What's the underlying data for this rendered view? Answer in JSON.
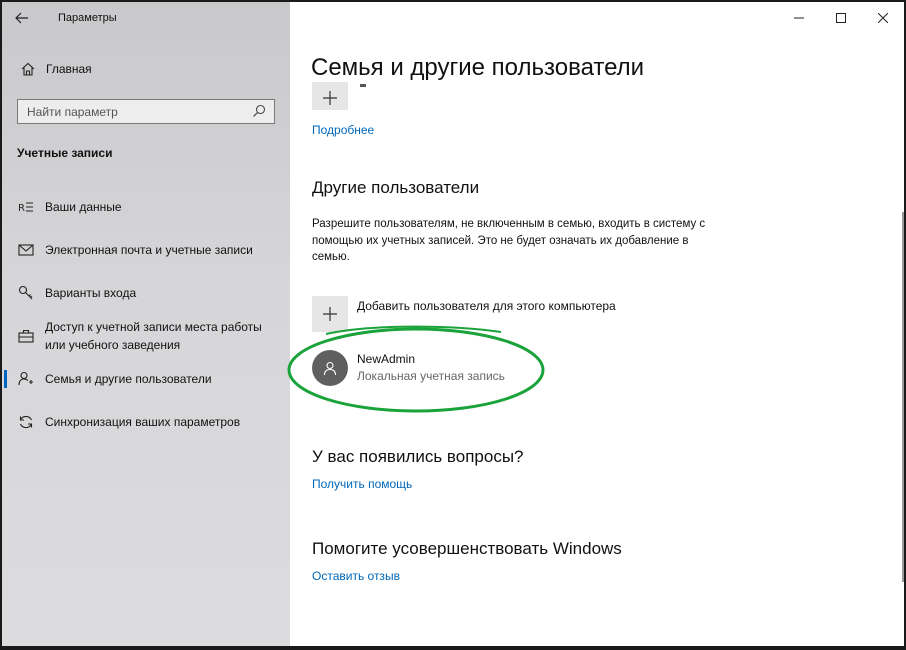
{
  "window": {
    "title": "Параметры",
    "controls": {
      "minimize": "—",
      "maximize": "☐",
      "close": "✕"
    }
  },
  "sidebar": {
    "home_label": "Главная",
    "search_placeholder": "Найти параметр",
    "section_title": "Учетные записи",
    "items": [
      {
        "label": "Ваши данные",
        "icon": "user-card-icon",
        "active": false
      },
      {
        "label": "Электронная почта и учетные записи",
        "icon": "mail-icon",
        "active": false
      },
      {
        "label": "Варианты входа",
        "icon": "key-icon",
        "active": false
      },
      {
        "label": "Доступ к учетной записи места работы или учебного заведения",
        "icon": "briefcase-icon",
        "active": false
      },
      {
        "label": "Семья и другие пользователи",
        "icon": "person-add-icon",
        "active": true
      },
      {
        "label": "Синхронизация ваших параметров",
        "icon": "sync-icon",
        "active": false
      }
    ]
  },
  "main": {
    "page_title": "Семья и другие пользователи",
    "more_link": "Подробнее",
    "other_users": {
      "heading": "Другие пользователи",
      "description": "Разрешите пользователям, не включенным в семью, входить в систему с помощью их учетных записей. Это не будет означать их добавление в семью.",
      "add_user_label": "Добавить пользователя для этого компьютера",
      "users": [
        {
          "name": "NewAdmin",
          "type": "Локальная учетная запись"
        }
      ]
    },
    "questions": {
      "heading": "У вас появились вопросы?",
      "link": "Получить помощь"
    },
    "improve": {
      "heading": "Помогите усовершенствовать Windows",
      "link": "Оставить отзыв"
    }
  },
  "colors": {
    "accent": "#0067b8",
    "highlight_ring": "#1aa33a",
    "sidebar_bg": "#d3d3d5"
  }
}
